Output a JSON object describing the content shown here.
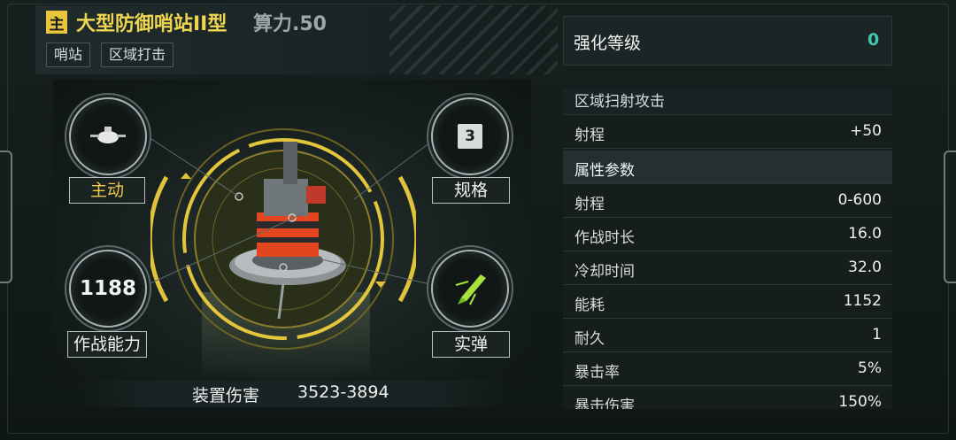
{
  "header": {
    "badge": "主",
    "title": "大型防御哨站II型",
    "power": "算力.50",
    "tags": [
      "哨站",
      "区域打击"
    ]
  },
  "center": {
    "top_left_label": "主动",
    "top_right_value": "3",
    "top_right_label": "规格",
    "bottom_left_value": "1188",
    "bottom_left_label": "作战能力",
    "bottom_right_label": "实弹",
    "damage_label": "装置伤害",
    "damage_value": "3523-3894"
  },
  "panel": {
    "enhance_label": "强化等级",
    "enhance_value": "0",
    "skill_title": "区域扫射攻击",
    "skill_rows": [
      {
        "k": "射程",
        "v": "+50"
      }
    ],
    "attr_title": "属性参数",
    "attr_rows": [
      {
        "k": "射程",
        "v": "0-600"
      },
      {
        "k": "作战时长",
        "v": "16.0"
      },
      {
        "k": "冷却时间",
        "v": "32.0"
      },
      {
        "k": "能耗",
        "v": "1152"
      },
      {
        "k": "耐久",
        "v": "1"
      },
      {
        "k": "暴击率",
        "v": "5%"
      },
      {
        "k": "暴击伤害",
        "v": "150%"
      }
    ]
  },
  "colors": {
    "accent_gold": "#f0d650",
    "accent_teal": "#3fc7b0"
  },
  "icons": [
    "drone-icon",
    "number-badge-icon",
    "projectile-icon",
    "turret-artwork"
  ]
}
